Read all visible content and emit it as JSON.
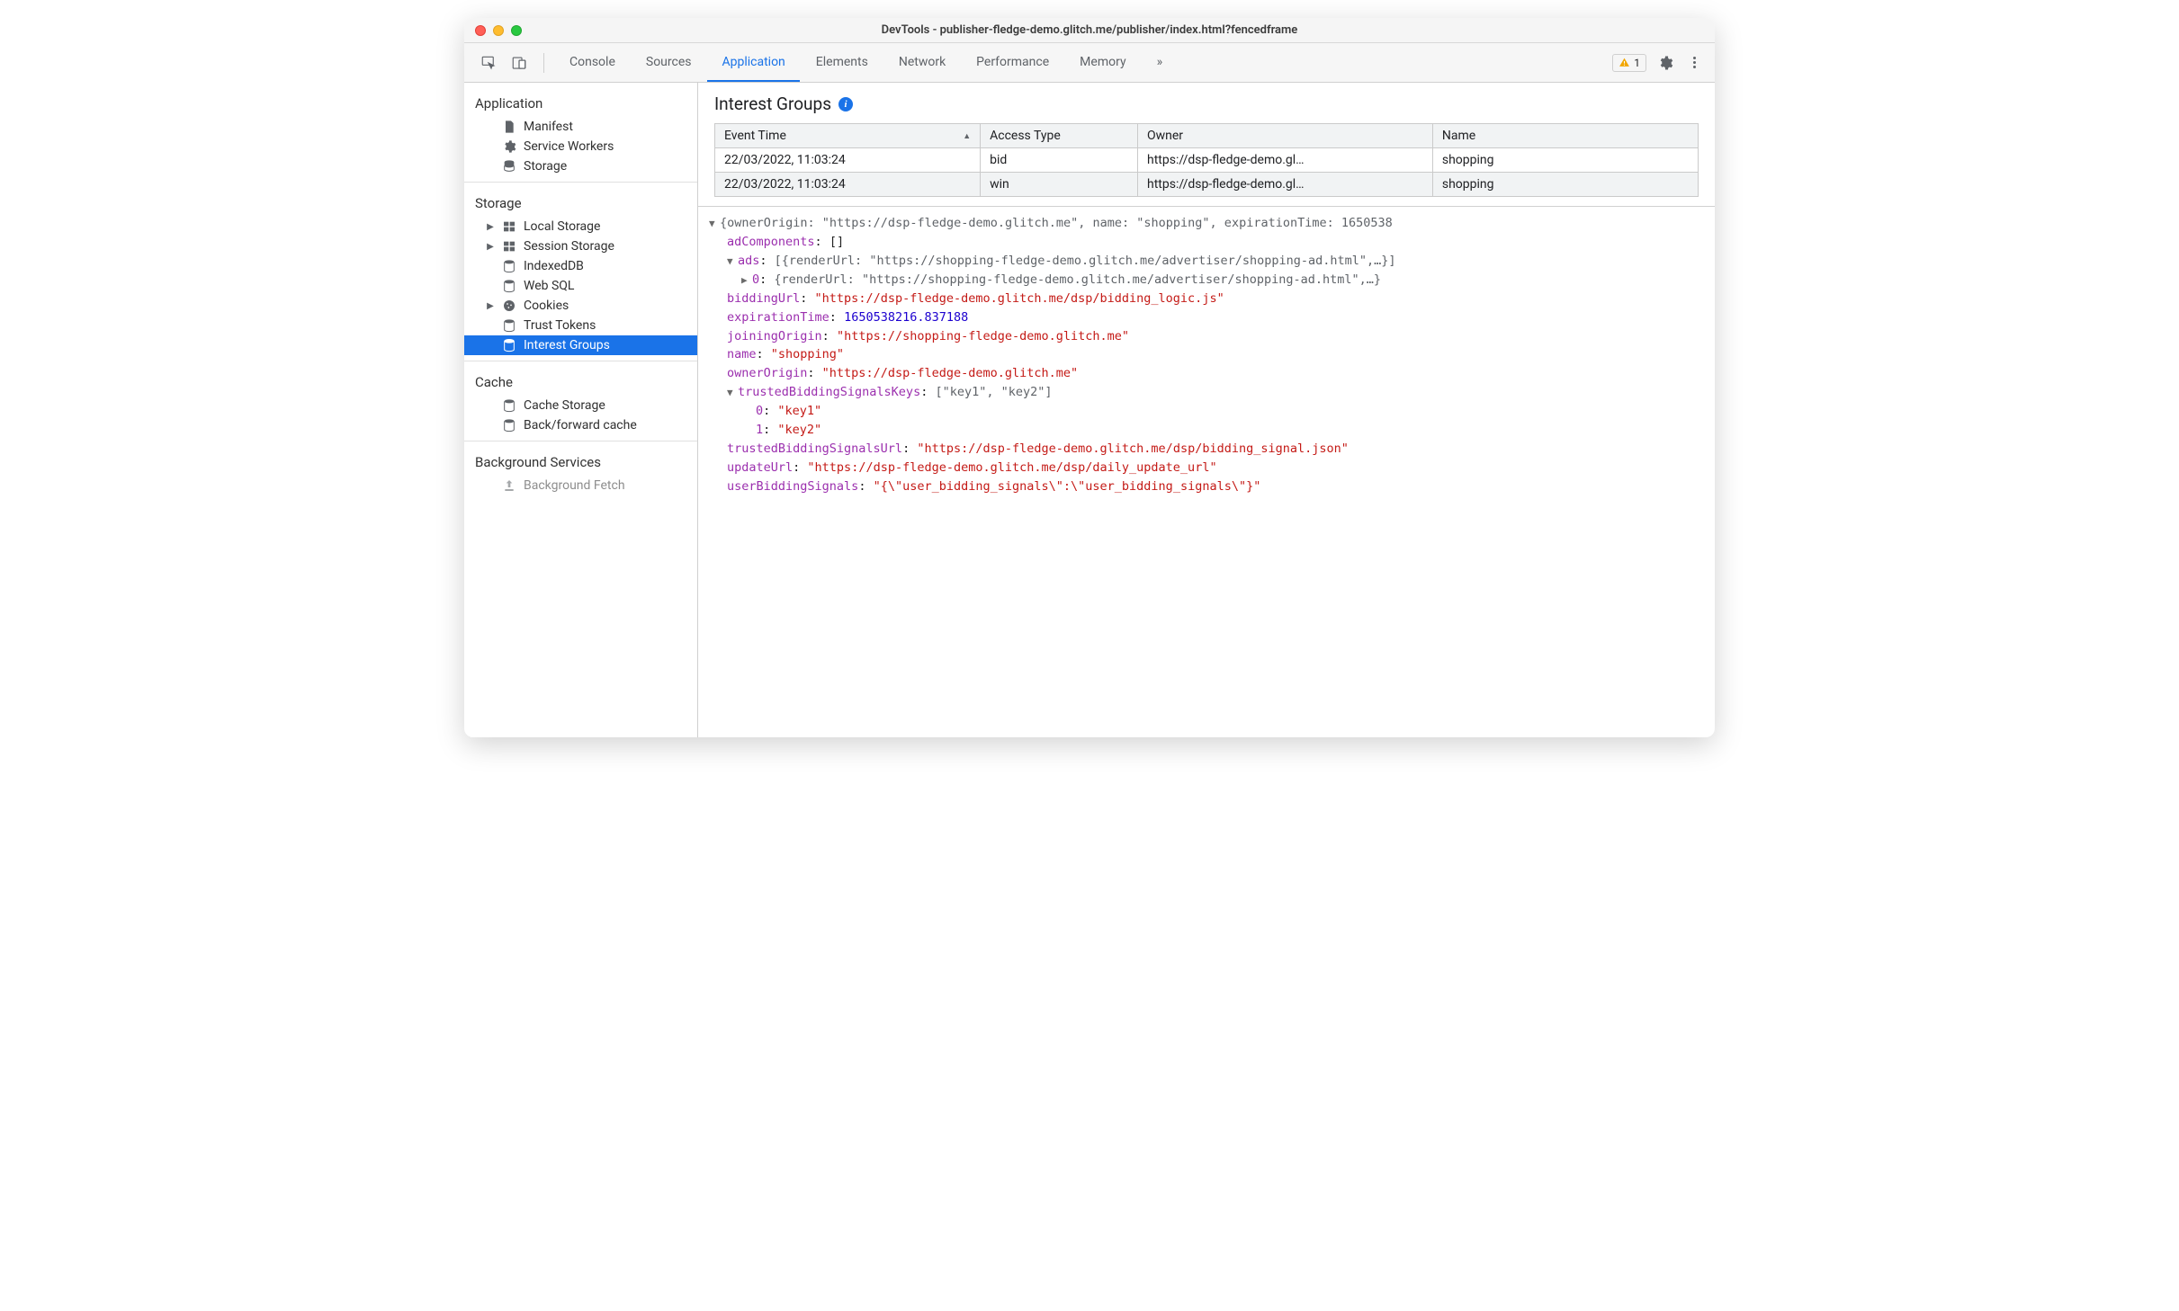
{
  "window": {
    "title": "DevTools - publisher-fledge-demo.glitch.me/publisher/index.html?fencedframe"
  },
  "toolbar": {
    "tabs": [
      "Console",
      "Sources",
      "Application",
      "Elements",
      "Network",
      "Performance",
      "Memory"
    ],
    "active_tab": "Application",
    "more_label": "»",
    "warning_count": "1"
  },
  "sidebar": {
    "sections": {
      "application": {
        "title": "Application",
        "items": [
          {
            "label": "Manifest",
            "icon": "file"
          },
          {
            "label": "Service Workers",
            "icon": "gear"
          },
          {
            "label": "Storage",
            "icon": "storage"
          }
        ]
      },
      "storage": {
        "title": "Storage",
        "items": [
          {
            "label": "Local Storage",
            "icon": "table",
            "expandable": true
          },
          {
            "label": "Session Storage",
            "icon": "table",
            "expandable": true
          },
          {
            "label": "IndexedDB",
            "icon": "storage",
            "expandable": false
          },
          {
            "label": "Web SQL",
            "icon": "storage",
            "expandable": false
          },
          {
            "label": "Cookies",
            "icon": "cookie",
            "expandable": true
          },
          {
            "label": "Trust Tokens",
            "icon": "storage",
            "expandable": false
          },
          {
            "label": "Interest Groups",
            "icon": "storage",
            "selected": true
          }
        ]
      },
      "cache": {
        "title": "Cache",
        "items": [
          {
            "label": "Cache Storage",
            "icon": "storage"
          },
          {
            "label": "Back/forward cache",
            "icon": "storage"
          }
        ]
      },
      "background": {
        "title": "Background Services",
        "items": [
          {
            "label": "Background Fetch",
            "icon": "upload"
          }
        ]
      }
    }
  },
  "pane": {
    "title": "Interest Groups",
    "columns": [
      "Event Time",
      "Access Type",
      "Owner",
      "Name"
    ],
    "rows": [
      {
        "time": "22/03/2022, 11:03:24",
        "type": "bid",
        "owner": "https://dsp-fledge-demo.gl…",
        "name": "shopping"
      },
      {
        "time": "22/03/2022, 11:03:24",
        "type": "win",
        "owner": "https://dsp-fledge-demo.gl…",
        "name": "shopping"
      }
    ]
  },
  "object": {
    "summary": "{ownerOrigin: \"https://dsp-fledge-demo.glitch.me\", name: \"shopping\", expirationTime: 1650538",
    "adComponents": "[]",
    "ads_preview": "[{renderUrl: \"https://shopping-fledge-demo.glitch.me/advertiser/shopping-ad.html\",…}]",
    "ads_0_preview": "{renderUrl: \"https://shopping-fledge-demo.glitch.me/advertiser/shopping-ad.html\",…}",
    "biddingUrl": "\"https://dsp-fledge-demo.glitch.me/dsp/bidding_logic.js\"",
    "expirationTime": "1650538216.837188",
    "joiningOrigin": "\"https://shopping-fledge-demo.glitch.me\"",
    "name": "\"shopping\"",
    "ownerOrigin": "\"https://dsp-fledge-demo.glitch.me\"",
    "trustedBiddingSignalsKeys_preview": "[\"key1\", \"key2\"]",
    "key0": "\"key1\"",
    "key1": "\"key2\"",
    "trustedBiddingSignalsUrl": "\"https://dsp-fledge-demo.glitch.me/dsp/bidding_signal.json\"",
    "updateUrl": "\"https://dsp-fledge-demo.glitch.me/dsp/daily_update_url\"",
    "userBiddingSignals": "\"{\\\"user_bidding_signals\\\":\\\"user_bidding_signals\\\"}\""
  }
}
